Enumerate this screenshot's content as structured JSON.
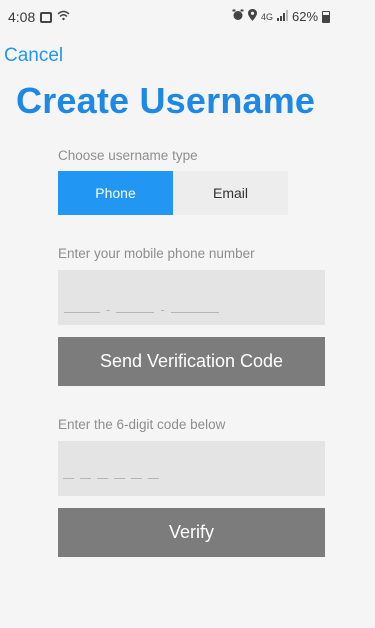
{
  "status_bar": {
    "time": "4:08",
    "network": "4G",
    "battery": "62%"
  },
  "header": {
    "cancel_label": "Cancel",
    "title": "Create Username"
  },
  "username_type": {
    "label": "Choose username type",
    "options": [
      "Phone",
      "Email"
    ],
    "selected": "Phone",
    "selected_color": "#2196f3"
  },
  "phone": {
    "label": "Enter your mobile phone number",
    "separator": "-"
  },
  "send_button": {
    "label": "Send Verification Code"
  },
  "code": {
    "label": "Enter the 6-digit code below"
  },
  "verify_button": {
    "label": "Verify"
  }
}
